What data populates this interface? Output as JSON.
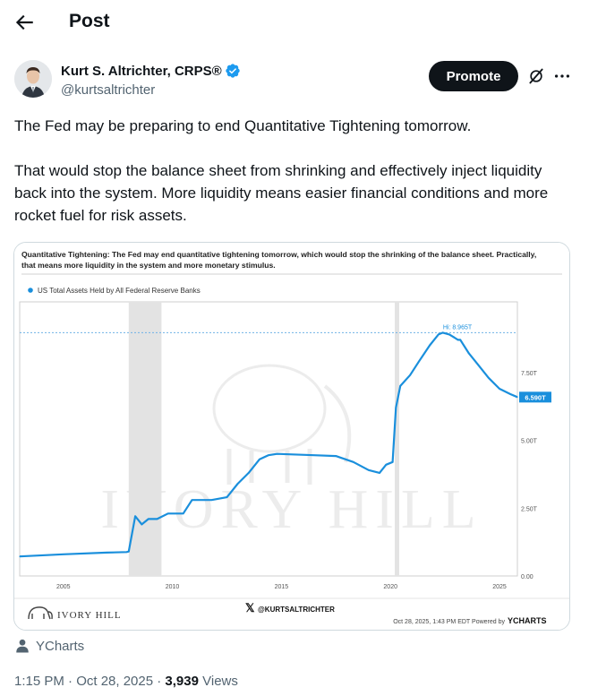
{
  "header": {
    "title": "Post"
  },
  "author": {
    "name": "Kurt S. Altrichter, CRPS®",
    "handle": "@kurtsaltrichter",
    "verified": true
  },
  "actions": {
    "promote_label": "Promote",
    "grok_icon": "grok-icon",
    "more_icon": "more-icon"
  },
  "tweet": {
    "paragraphs": [
      "The Fed may be preparing to end Quantitative Tightening tomorrow.",
      "That would stop the balance sheet from shrinking and effectively inject liquidity back into the system. More liquidity means easier financial conditions and more rocket fuel for risk assets."
    ]
  },
  "media": {
    "caption_line1": "Quantitative Tightening: The Fed may end quantitative tightening tomorrow, which would stop the shrinking of the balance sheet. Practically,",
    "caption_line2": "that means more liquidity in the system and more monetary stimulus.",
    "legend": "US Total Assets Held by All Federal Reserve Banks",
    "brand_left": "IVORY HILL",
    "watermark": "IVORY HILL",
    "brand_center": "@KURTSALTRICHTER",
    "footer_right_prefix": "Oct 28, 2025, 1:43 PM EDT Powered by",
    "footer_right_brand": "YCHARTS"
  },
  "chart_data": {
    "type": "line",
    "series": [
      {
        "name": "US Total Assets Held by All Federal Reserve Banks",
        "x": [
          2003.0,
          2005.0,
          2007.0,
          2007.9,
          2008.0,
          2008.3,
          2008.6,
          2008.9,
          2009.3,
          2009.8,
          2010.5,
          2010.9,
          2011.4,
          2011.8,
          2012.5,
          2013.0,
          2013.5,
          2014.0,
          2014.4,
          2014.8,
          2015.5,
          2016.5,
          2017.5,
          2018.3,
          2019.0,
          2019.5,
          2019.8,
          2020.1,
          2020.25,
          2020.45,
          2020.9,
          2021.3,
          2021.8,
          2022.2,
          2022.4,
          2022.7,
          2023.1,
          2023.2,
          2023.6,
          2024.0,
          2024.5,
          2025.0,
          2025.5,
          2025.82
        ],
        "values": [
          0.72,
          0.8,
          0.86,
          0.88,
          0.9,
          2.2,
          1.9,
          2.1,
          2.1,
          2.3,
          2.3,
          2.8,
          2.8,
          2.8,
          2.9,
          3.4,
          3.8,
          4.3,
          4.45,
          4.5,
          4.48,
          4.45,
          4.42,
          4.2,
          3.9,
          3.8,
          4.1,
          4.2,
          6.2,
          7.0,
          7.4,
          7.9,
          8.5,
          8.9,
          8.965,
          8.9,
          8.7,
          8.7,
          8.2,
          7.8,
          7.3,
          6.9,
          6.7,
          6.59
        ]
      }
    ],
    "x_ticks": [
      "2005",
      "2010",
      "2015",
      "2020",
      "2025"
    ],
    "y_ticks": [
      "0.00",
      "2.50T",
      "5.00T",
      "7.50T"
    ],
    "y_range": [
      0,
      10.1
    ],
    "x_range": [
      2003,
      2025.82
    ],
    "high_label": "Hi: 8.965T",
    "high_value": 8.965,
    "last_label": "6.590T",
    "last_value": 6.59,
    "recessions": [
      [
        2008.0,
        2009.5
      ],
      [
        2020.2,
        2020.4
      ]
    ],
    "line_color": "#1a8fdc"
  },
  "source": {
    "label": "YCharts"
  },
  "meta": {
    "time": "1:15 PM · Oct 28, 2025 · ",
    "views_count": "3,939",
    "views_label": " Views"
  }
}
